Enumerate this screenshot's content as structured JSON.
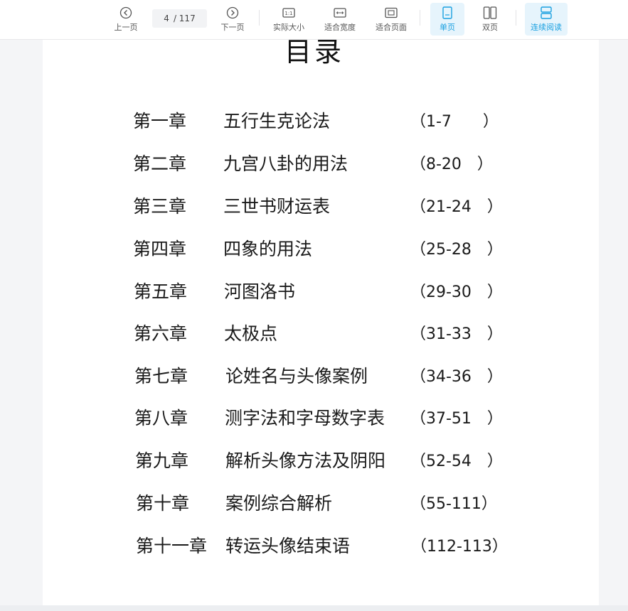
{
  "toolbar": {
    "prev_label": "上一页",
    "next_label": "下一页",
    "current_page": "4",
    "total_pages": "/ 117",
    "actual_size_label": "实际大小",
    "fit_width_label": "适合宽度",
    "fit_page_label": "适合页面",
    "single_page_label": "单页",
    "double_page_label": "双页",
    "continuous_label": "连续阅读",
    "accent_color": "#1aa0e0"
  },
  "document": {
    "title": "目录",
    "toc": [
      {
        "chapter": "第一章",
        "title": "五行生克论法",
        "pages": "（1-7　　）"
      },
      {
        "chapter": "第二章",
        "title": "九宫八卦的用法",
        "pages": "（8-20　）"
      },
      {
        "chapter": "第三章",
        "title": "三世书财运表",
        "pages": "（21-24　）"
      },
      {
        "chapter": "第四章",
        "title": "四象的用法",
        "pages": "（25-28　）"
      },
      {
        "chapter": "第五章",
        "title": "河图洛书",
        "pages": "（29-30　）"
      },
      {
        "chapter": "第六章",
        "title": "太极点",
        "pages": "（31-33　）"
      },
      {
        "chapter": "第七章",
        "title": "论姓名与头像案例",
        "pages": "（34-36　）"
      },
      {
        "chapter": "第八章",
        "title": "测字法和字母数字表",
        "pages": "（37-51　）"
      },
      {
        "chapter": "第九章",
        "title": "解析头像方法及阴阳",
        "pages": "（52-54　）"
      },
      {
        "chapter": "第十章",
        "title": "案例综合解析",
        "pages": "（55-111）"
      },
      {
        "chapter": "第十一章",
        "title": "转运头像结束语",
        "pages": "（112-113）"
      }
    ]
  }
}
